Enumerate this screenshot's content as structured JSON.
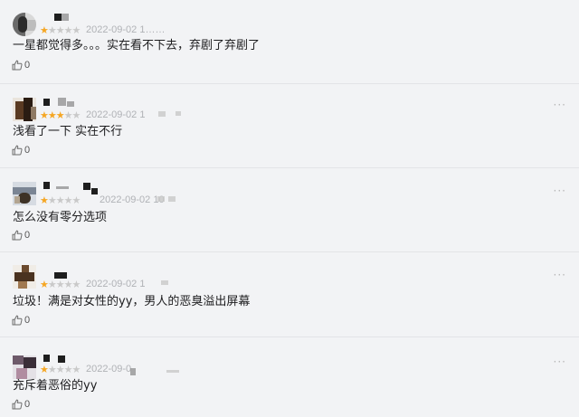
{
  "reviews": [
    {
      "stars_filled": 1,
      "stars_total": 5,
      "date": "2022-09-02 1……",
      "content": "一星都觉得多。。。实在看不下去，弃剧了弃剧了",
      "likes": "0",
      "has_more": false
    },
    {
      "stars_filled": 3,
      "stars_total": 5,
      "date": "2022-09-02 1",
      "content": "浅看了一下 实在不行",
      "likes": "0",
      "has_more": true
    },
    {
      "stars_filled": 1,
      "stars_total": 5,
      "date": "2022-09-02 10",
      "content": "怎么没有零分选项",
      "likes": "0",
      "has_more": true
    },
    {
      "stars_filled": 1,
      "stars_total": 5,
      "date": "2022-09-02 1",
      "content": "垃圾！满是对女性的yy，男人的恶臭溢出屏幕",
      "likes": "0",
      "has_more": true
    },
    {
      "stars_filled": 1,
      "stars_total": 5,
      "date": "2022-09-0",
      "content": "充斥着恶俗的yy",
      "likes": "0",
      "has_more": true
    }
  ],
  "icons": {
    "like": "thumbs-up-icon",
    "more": "more-dots-icon",
    "star": "star-icon"
  },
  "colors": {
    "star_filled": "#f5a623",
    "star_empty": "#c9c9c9",
    "date_text": "#b0b2b6",
    "content_text": "#1d1d1f",
    "background": "#f2f3f5",
    "divider": "#e3e4e7"
  }
}
